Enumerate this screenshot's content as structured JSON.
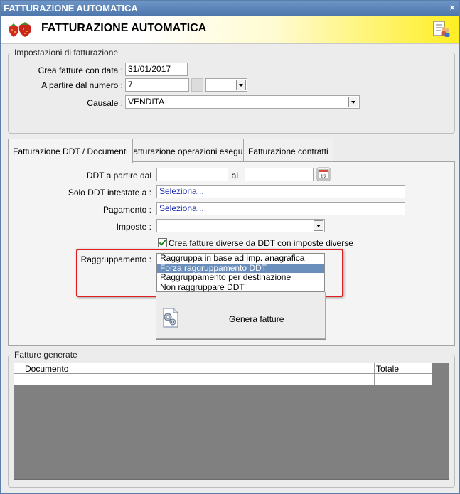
{
  "window": {
    "title": "FATTURAZIONE AUTOMATICA",
    "close_glyph": "×"
  },
  "header": {
    "title": "FATTURAZIONE AUTOMATICA",
    "logo_icon": "strawberry-logo-icon",
    "action_icon": "users-document-icon"
  },
  "settings": {
    "legend": "Impostazioni di fatturazione",
    "date_label": "Crea fatture con data :",
    "date_value": "31/01/2017",
    "from_number_label": "A partire dal numero :",
    "from_number_value": "7",
    "suffix_value": "",
    "causale_label": "Causale :",
    "causale_value": "VENDITA"
  },
  "tabs": [
    {
      "label": "Fatturazione DDT / Documenti",
      "active": true
    },
    {
      "label": "Fatturazione operazioni eseguite",
      "active": false
    },
    {
      "label": "Fatturazione contratti",
      "active": false
    }
  ],
  "ddt": {
    "from_label": "DDT a partire dal",
    "from_value": "",
    "to_label": "al",
    "to_value": "",
    "solo_label": "Solo DDT intestate a :",
    "solo_value": "Seleziona...",
    "pagamento_label": "Pagamento :",
    "pagamento_value": "Seleziona...",
    "imposte_label": "Imposte :",
    "imposte_value": "",
    "diverse_checkbox_label": "Crea fatture diverse da DDT con imposte diverse",
    "diverse_checked": true,
    "raggruppamento_label": "Raggruppamento :",
    "raggruppamento_options": [
      "Raggruppa in base ad imp. anagrafica",
      "Forza raggruppamento DDT",
      "Raggruppamento per destinazione",
      "Non raggruppare DDT"
    ],
    "raggruppamento_selected_index": 1,
    "generate_button": "Genera fatture"
  },
  "results": {
    "legend": "Fatture generate",
    "columns": [
      "Documento",
      "Totale"
    ],
    "rows": [
      [
        "",
        ""
      ]
    ]
  },
  "colors": {
    "title_bar": "#5b83b8",
    "header_accent": "#ffee22",
    "selection": "#6b8fbd",
    "highlight_frame": "#e02020"
  }
}
